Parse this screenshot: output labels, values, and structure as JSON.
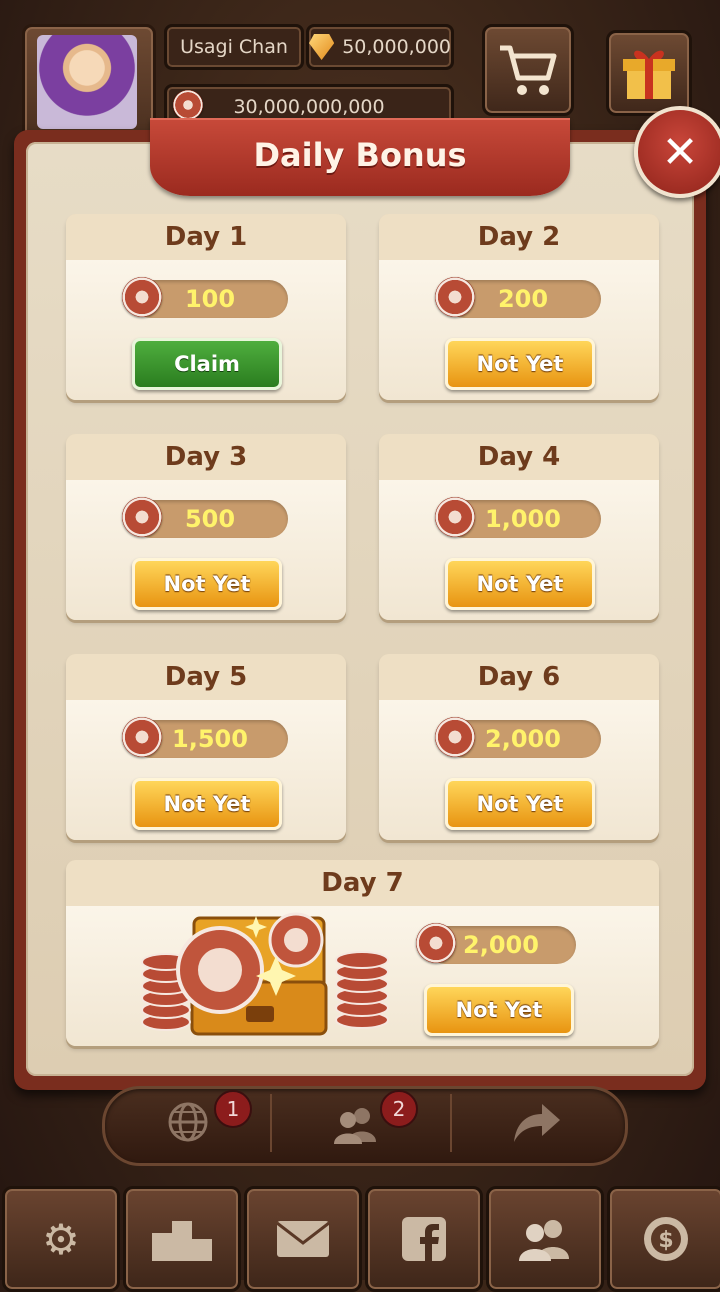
{
  "header": {
    "username": "Usagi Chan",
    "gems": "50,000,000",
    "chips": "30,000,000,000",
    "shop_icon": "cart-icon",
    "gift_icon": "gift-icon"
  },
  "dialog": {
    "title": "Daily Bonus",
    "close_label": "✕"
  },
  "days": [
    {
      "label": "Day 1",
      "amount": "100",
      "button": "Claim",
      "state": "claimable"
    },
    {
      "label": "Day 2",
      "amount": "200",
      "button": "Not Yet",
      "state": "locked"
    },
    {
      "label": "Day 3",
      "amount": "500",
      "button": "Not Yet",
      "state": "locked"
    },
    {
      "label": "Day 4",
      "amount": "1,000",
      "button": "Not Yet",
      "state": "locked"
    },
    {
      "label": "Day 5",
      "amount": "1,500",
      "button": "Not Yet",
      "state": "locked"
    },
    {
      "label": "Day 6",
      "amount": "2,000",
      "button": "Not Yet",
      "state": "locked"
    },
    {
      "label": "Day 7",
      "amount": "2,000",
      "button": "Not Yet",
      "state": "locked"
    }
  ],
  "social": {
    "world_badge": "1",
    "friends_badge": "2"
  },
  "nav": {
    "settings_icon": "gear-icon",
    "leaderboard_icon": "podium-icon",
    "mail_icon": "mail-icon",
    "facebook_icon": "facebook-icon",
    "friends_icon": "friends-icon",
    "cashier_icon": "dollar-chip-icon"
  },
  "colors": {
    "claim_green": "#2a7d1f",
    "not_yet_orange": "#e89411",
    "ribbon_red": "#9b2a1f",
    "amount_text": "#fff36b"
  }
}
